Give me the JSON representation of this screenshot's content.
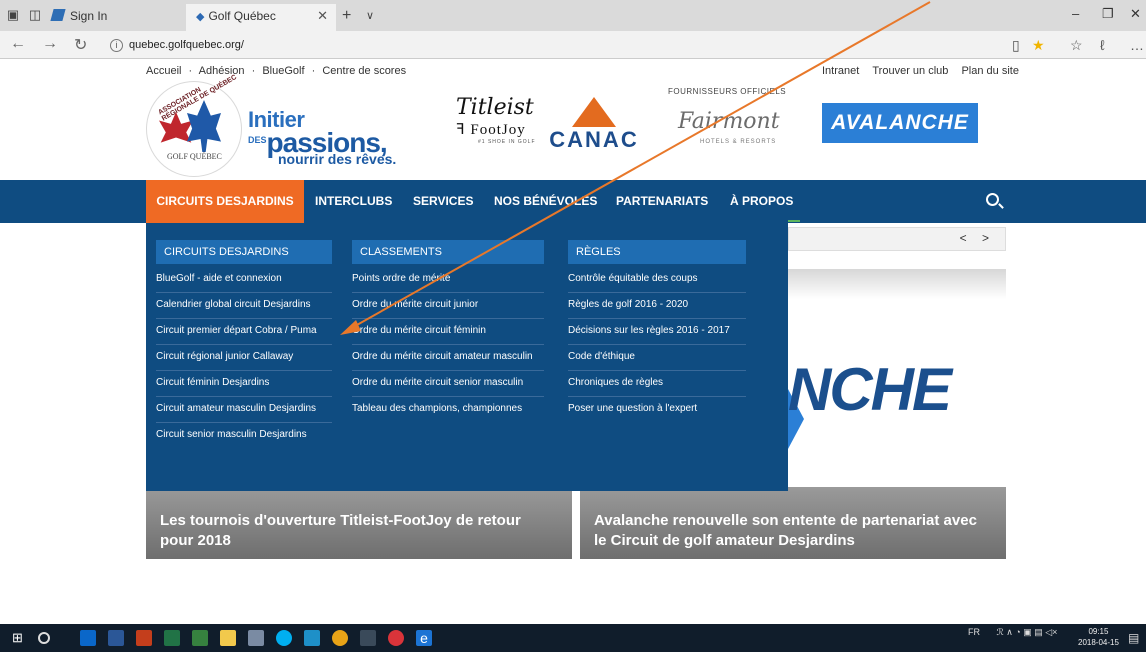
{
  "browser": {
    "tab_inactive_label": "Sign In",
    "tab_active_label": "Golf Québec",
    "url": "quebec.golfquebec.org/"
  },
  "site": {
    "top_links": [
      "Accueil",
      "Adhésion",
      "BlueGolf",
      "Centre de scores"
    ],
    "top_links_sep": "·",
    "right_links": [
      "Intranet",
      "Trouver un club",
      "Plan du site"
    ],
    "logo": {
      "ring_text": "ASSOCIATION RÉGIONALE DE QUÉBEC",
      "name": "GOLF QUÉBEC"
    },
    "slogan": {
      "line1": "Initier",
      "des": "DES",
      "line2": "passions,",
      "line3": "nourrir des rêves."
    },
    "sponsors": {
      "titleist": "Titleist",
      "footjoy": "FootJoy",
      "footjoy_sub": "#1 SHOE IN GOLF",
      "canac": "CANAC",
      "fournisseurs": "FOURNISSEURS OFFICIELS",
      "fairmont": "Fairmont",
      "fairmont_sub": "HOTELS & RESORTS",
      "avalanche": "AVALANCHE"
    }
  },
  "nav": {
    "items": [
      "CIRCUITS DESJARDINS",
      "INTERCLUBS",
      "SERVICES",
      "NOS BÉNÉVOLES",
      "PARTENARIATS",
      "À PROPOS"
    ],
    "active_color": "#ef6a24",
    "bar_color": "#0f4c81"
  },
  "megamenu": {
    "columns": [
      {
        "heading": "CIRCUITS DESJARDINS",
        "items": [
          "BlueGolf - aide et connexion",
          "Calendrier global circuit Desjardins",
          "Circuit premier départ Cobra / Puma",
          "Circuit régional junior Callaway",
          "Circuit féminin Desjardins",
          "Circuit amateur masculin Desjardins",
          "Circuit senior masculin Desjardins"
        ]
      },
      {
        "heading": "CLASSEMENTS",
        "items": [
          "Points ordre de mérite",
          "Ordre du mérite circuit junior",
          "Ordre du mérite circuit féminin",
          "Ordre du mérite circuit amateur masculin",
          "Ordre du mérite circuit senior masculin",
          "Tableau des champions, championnes"
        ]
      },
      {
        "heading": "RÈGLES",
        "items": [
          "Contrôle équitable des coups",
          "Règles de golf 2016 - 2020",
          "Décisions sur les règles 2016 - 2017",
          "Code d'éthique",
          "Chroniques de règles",
          "Poser une question à l'expert"
        ]
      }
    ]
  },
  "content": {
    "hero_text": "NCHE",
    "slider_arrows": "< >",
    "cards": [
      "Les tournois d'ouverture Titleist-FootJoy de retour pour 2018",
      "Avalanche renouvelle son entente de partenariat avec le Circuit de golf amateur Desjardins"
    ]
  },
  "taskbar": {
    "lang": "FR",
    "time": "09:15",
    "date": "2018-04-15"
  },
  "annotation_color": "#e8782a"
}
